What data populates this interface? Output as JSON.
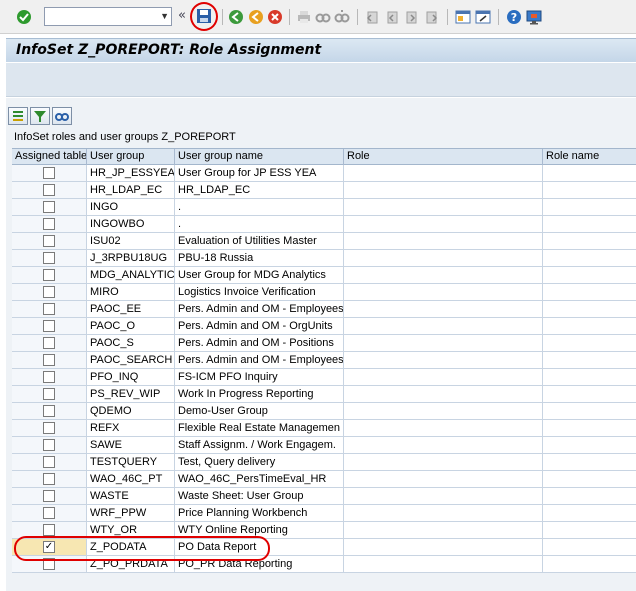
{
  "toolbar": {
    "command_field_value": "",
    "icons": [
      "enter-icon",
      "back-icon",
      "exit-icon",
      "cancel-icon",
      "print-icon",
      "find-icon",
      "find-next-icon",
      "first-page-icon",
      "previous-page-icon",
      "next-page-icon",
      "last-page-icon",
      "create-session-icon",
      "shortcut-icon",
      "help-icon",
      "customize-layout-icon"
    ]
  },
  "window": {
    "title": "InfoSet Z_POREPORT: Role Assignment"
  },
  "grid": {
    "caption": "InfoSet roles and user groups Z_POREPORT",
    "columns": [
      "Assigned table",
      "User group",
      "User group name",
      "Role",
      "Role name"
    ],
    "rows": [
      {
        "checked": false,
        "group": "HR_JP_ESSYEA",
        "name": "User Group for JP ESS YEA"
      },
      {
        "checked": false,
        "group": "HR_LDAP_EC",
        "name": "HR_LDAP_EC"
      },
      {
        "checked": false,
        "group": "INGO",
        "name": "."
      },
      {
        "checked": false,
        "group": "INGOWBO",
        "name": "."
      },
      {
        "checked": false,
        "group": "ISU02",
        "name": "Evaluation of Utilities Master"
      },
      {
        "checked": false,
        "group": "J_3RPBU18UG",
        "name": "PBU-18 Russia"
      },
      {
        "checked": false,
        "group": "MDG_ANALYTIC",
        "name": "User Group for MDG Analytics"
      },
      {
        "checked": false,
        "group": "MIRO",
        "name": "Logistics Invoice Verification"
      },
      {
        "checked": false,
        "group": "PAOC_EE",
        "name": "Pers. Admin and OM - Employees"
      },
      {
        "checked": false,
        "group": "PAOC_O",
        "name": "Pers. Admin and OM - OrgUnits"
      },
      {
        "checked": false,
        "group": "PAOC_S",
        "name": "Pers. Admin and OM - Positions"
      },
      {
        "checked": false,
        "group": "PAOC_SEARCH",
        "name": "Pers. Admin and OM - Employees"
      },
      {
        "checked": false,
        "group": "PFO_INQ",
        "name": "FS-ICM PFO Inquiry"
      },
      {
        "checked": false,
        "group": "PS_REV_WIP",
        "name": "Work In Progress Reporting"
      },
      {
        "checked": false,
        "group": "QDEMO",
        "name": "Demo-User Group"
      },
      {
        "checked": false,
        "group": "REFX",
        "name": "Flexible Real Estate Managemen"
      },
      {
        "checked": false,
        "group": "SAWE",
        "name": "Staff Assignm. / Work Engagem."
      },
      {
        "checked": false,
        "group": "TESTQUERY",
        "name": "Test, Query delivery"
      },
      {
        "checked": false,
        "group": "WAO_46C_PT",
        "name": "WAO_46C_PersTimeEval_HR"
      },
      {
        "checked": false,
        "group": "WASTE",
        "name": "Waste Sheet: User Group"
      },
      {
        "checked": false,
        "group": "WRF_PPW",
        "name": "Price Planning Workbench"
      },
      {
        "checked": false,
        "group": "WTY_OR",
        "name": "WTY Online Reporting"
      },
      {
        "checked": true,
        "group": "Z_PODATA",
        "name": "PO Data Report"
      },
      {
        "checked": false,
        "group": "Z_PO_PRDATA",
        "name": "PO_PR Data Reporting"
      }
    ]
  }
}
